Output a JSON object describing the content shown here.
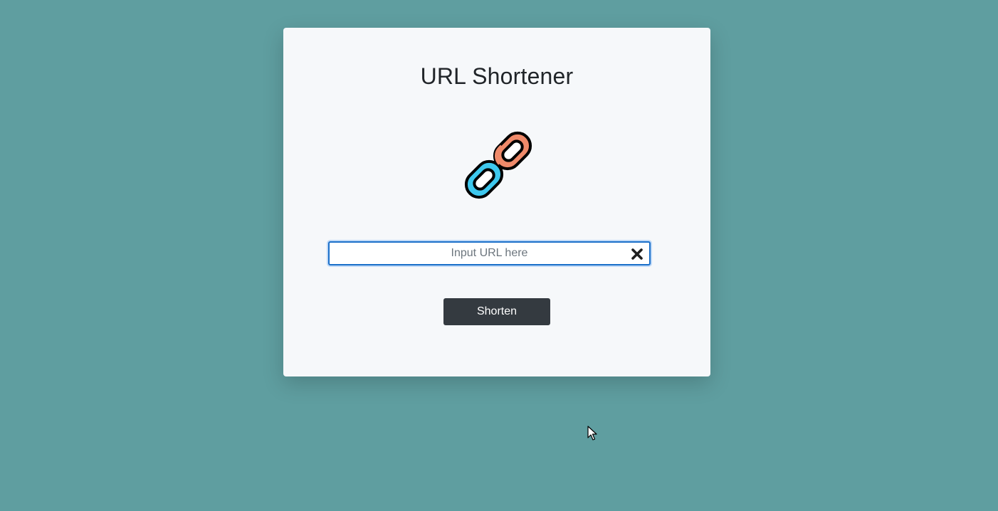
{
  "card": {
    "title": "URL Shortener"
  },
  "logo": {
    "icon": "chain-link-icon",
    "colors": {
      "left_link": "#3ec8ee",
      "right_link": "#ef8a6a",
      "outline": "#000000"
    }
  },
  "url_input": {
    "value": "",
    "placeholder": "Input URL here"
  },
  "clear_button": {
    "icon": "close-icon"
  },
  "shorten_button": {
    "label": "Shorten"
  },
  "colors": {
    "background": "#5f9ea0",
    "card": "#f6f8fa",
    "button": "#343a40",
    "input_focus": "#1a6fc9"
  }
}
